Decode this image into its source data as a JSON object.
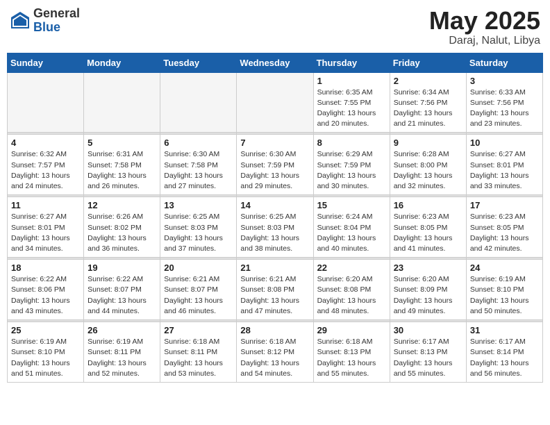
{
  "header": {
    "logo_general": "General",
    "logo_blue": "Blue",
    "title": "May 2025",
    "location": "Daraj, Nalut, Libya"
  },
  "weekdays": [
    "Sunday",
    "Monday",
    "Tuesday",
    "Wednesday",
    "Thursday",
    "Friday",
    "Saturday"
  ],
  "weeks": [
    [
      {
        "day": "",
        "info": ""
      },
      {
        "day": "",
        "info": ""
      },
      {
        "day": "",
        "info": ""
      },
      {
        "day": "",
        "info": ""
      },
      {
        "day": "1",
        "info": "Sunrise: 6:35 AM\nSunset: 7:55 PM\nDaylight: 13 hours\nand 20 minutes."
      },
      {
        "day": "2",
        "info": "Sunrise: 6:34 AM\nSunset: 7:56 PM\nDaylight: 13 hours\nand 21 minutes."
      },
      {
        "day": "3",
        "info": "Sunrise: 6:33 AM\nSunset: 7:56 PM\nDaylight: 13 hours\nand 23 minutes."
      }
    ],
    [
      {
        "day": "4",
        "info": "Sunrise: 6:32 AM\nSunset: 7:57 PM\nDaylight: 13 hours\nand 24 minutes."
      },
      {
        "day": "5",
        "info": "Sunrise: 6:31 AM\nSunset: 7:58 PM\nDaylight: 13 hours\nand 26 minutes."
      },
      {
        "day": "6",
        "info": "Sunrise: 6:30 AM\nSunset: 7:58 PM\nDaylight: 13 hours\nand 27 minutes."
      },
      {
        "day": "7",
        "info": "Sunrise: 6:30 AM\nSunset: 7:59 PM\nDaylight: 13 hours\nand 29 minutes."
      },
      {
        "day": "8",
        "info": "Sunrise: 6:29 AM\nSunset: 7:59 PM\nDaylight: 13 hours\nand 30 minutes."
      },
      {
        "day": "9",
        "info": "Sunrise: 6:28 AM\nSunset: 8:00 PM\nDaylight: 13 hours\nand 32 minutes."
      },
      {
        "day": "10",
        "info": "Sunrise: 6:27 AM\nSunset: 8:01 PM\nDaylight: 13 hours\nand 33 minutes."
      }
    ],
    [
      {
        "day": "11",
        "info": "Sunrise: 6:27 AM\nSunset: 8:01 PM\nDaylight: 13 hours\nand 34 minutes."
      },
      {
        "day": "12",
        "info": "Sunrise: 6:26 AM\nSunset: 8:02 PM\nDaylight: 13 hours\nand 36 minutes."
      },
      {
        "day": "13",
        "info": "Sunrise: 6:25 AM\nSunset: 8:03 PM\nDaylight: 13 hours\nand 37 minutes."
      },
      {
        "day": "14",
        "info": "Sunrise: 6:25 AM\nSunset: 8:03 PM\nDaylight: 13 hours\nand 38 minutes."
      },
      {
        "day": "15",
        "info": "Sunrise: 6:24 AM\nSunset: 8:04 PM\nDaylight: 13 hours\nand 40 minutes."
      },
      {
        "day": "16",
        "info": "Sunrise: 6:23 AM\nSunset: 8:05 PM\nDaylight: 13 hours\nand 41 minutes."
      },
      {
        "day": "17",
        "info": "Sunrise: 6:23 AM\nSunset: 8:05 PM\nDaylight: 13 hours\nand 42 minutes."
      }
    ],
    [
      {
        "day": "18",
        "info": "Sunrise: 6:22 AM\nSunset: 8:06 PM\nDaylight: 13 hours\nand 43 minutes."
      },
      {
        "day": "19",
        "info": "Sunrise: 6:22 AM\nSunset: 8:07 PM\nDaylight: 13 hours\nand 44 minutes."
      },
      {
        "day": "20",
        "info": "Sunrise: 6:21 AM\nSunset: 8:07 PM\nDaylight: 13 hours\nand 46 minutes."
      },
      {
        "day": "21",
        "info": "Sunrise: 6:21 AM\nSunset: 8:08 PM\nDaylight: 13 hours\nand 47 minutes."
      },
      {
        "day": "22",
        "info": "Sunrise: 6:20 AM\nSunset: 8:08 PM\nDaylight: 13 hours\nand 48 minutes."
      },
      {
        "day": "23",
        "info": "Sunrise: 6:20 AM\nSunset: 8:09 PM\nDaylight: 13 hours\nand 49 minutes."
      },
      {
        "day": "24",
        "info": "Sunrise: 6:19 AM\nSunset: 8:10 PM\nDaylight: 13 hours\nand 50 minutes."
      }
    ],
    [
      {
        "day": "25",
        "info": "Sunrise: 6:19 AM\nSunset: 8:10 PM\nDaylight: 13 hours\nand 51 minutes."
      },
      {
        "day": "26",
        "info": "Sunrise: 6:19 AM\nSunset: 8:11 PM\nDaylight: 13 hours\nand 52 minutes."
      },
      {
        "day": "27",
        "info": "Sunrise: 6:18 AM\nSunset: 8:11 PM\nDaylight: 13 hours\nand 53 minutes."
      },
      {
        "day": "28",
        "info": "Sunrise: 6:18 AM\nSunset: 8:12 PM\nDaylight: 13 hours\nand 54 minutes."
      },
      {
        "day": "29",
        "info": "Sunrise: 6:18 AM\nSunset: 8:13 PM\nDaylight: 13 hours\nand 55 minutes."
      },
      {
        "day": "30",
        "info": "Sunrise: 6:17 AM\nSunset: 8:13 PM\nDaylight: 13 hours\nand 55 minutes."
      },
      {
        "day": "31",
        "info": "Sunrise: 6:17 AM\nSunset: 8:14 PM\nDaylight: 13 hours\nand 56 minutes."
      }
    ]
  ]
}
